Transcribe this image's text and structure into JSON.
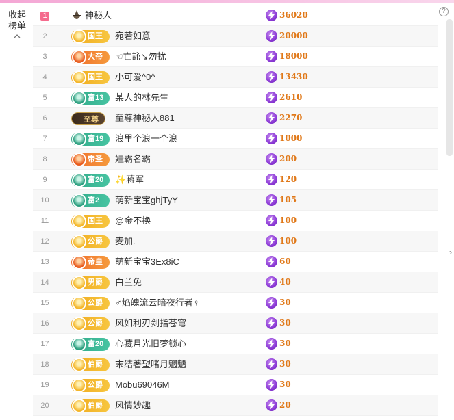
{
  "collapse": {
    "line1": "收起",
    "line2": "榜单"
  },
  "help_label": "?",
  "side_arrow": "›",
  "rows": [
    {
      "rank": "1",
      "badge": "",
      "badge_style": "none",
      "name": "神秘人",
      "score": "36020"
    },
    {
      "rank": "2",
      "badge": "国王",
      "badge_style": "gold",
      "name": "宛若如意",
      "score": "20000"
    },
    {
      "rank": "3",
      "badge": "大帝",
      "badge_style": "orange",
      "name": "☜亡訫↘勿扰",
      "score": "18000"
    },
    {
      "rank": "4",
      "badge": "国王",
      "badge_style": "gold",
      "name": "小可爱^0^",
      "score": "13430"
    },
    {
      "rank": "5",
      "badge": "富13",
      "badge_style": "teal",
      "name": "某人的林先生",
      "score": "2610"
    },
    {
      "rank": "6",
      "badge": "至尊",
      "badge_style": "dark",
      "name": "至尊神秘人881",
      "score": "2270"
    },
    {
      "rank": "7",
      "badge": "富19",
      "badge_style": "teal",
      "name": "浪里个浪一个浪",
      "score": "1000"
    },
    {
      "rank": "8",
      "badge": "帝圣",
      "badge_style": "orange",
      "name": "娃霸名霸",
      "score": "200"
    },
    {
      "rank": "9",
      "badge": "富20",
      "badge_style": "teal",
      "name": "✨蒋军",
      "score": "120"
    },
    {
      "rank": "10",
      "badge": "富2",
      "badge_style": "teal",
      "name": "萌新宝宝ghjTyY",
      "score": "105"
    },
    {
      "rank": "11",
      "badge": "国王",
      "badge_style": "gold",
      "name": "@金不换",
      "score": "100"
    },
    {
      "rank": "12",
      "badge": "公爵",
      "badge_style": "gold",
      "name": "麦加.",
      "score": "100"
    },
    {
      "rank": "13",
      "badge": "帝皇",
      "badge_style": "orange",
      "name": "萌新宝宝3Ex8iC",
      "score": "60"
    },
    {
      "rank": "14",
      "badge": "男爵",
      "badge_style": "gold",
      "name": "白兰免",
      "score": "40"
    },
    {
      "rank": "15",
      "badge": "公爵",
      "badge_style": "gold",
      "name": "♂焰魄流云暗夜行者♀",
      "score": "30"
    },
    {
      "rank": "16",
      "badge": "公爵",
      "badge_style": "gold",
      "name": "风如利刃剑指苍穹",
      "score": "30"
    },
    {
      "rank": "17",
      "badge": "富20",
      "badge_style": "teal",
      "name": "心藏月光旧梦锁心",
      "score": "30"
    },
    {
      "rank": "18",
      "badge": "伯爵",
      "badge_style": "gold",
      "name": "末结著望啫月魍魉",
      "score": "30"
    },
    {
      "rank": "19",
      "badge": "公爵",
      "badge_style": "gold",
      "name": "Mobu69046M",
      "score": "30"
    },
    {
      "rank": "20",
      "badge": "伯爵",
      "badge_style": "gold",
      "name": "风情妙趣",
      "score": "20"
    }
  ]
}
